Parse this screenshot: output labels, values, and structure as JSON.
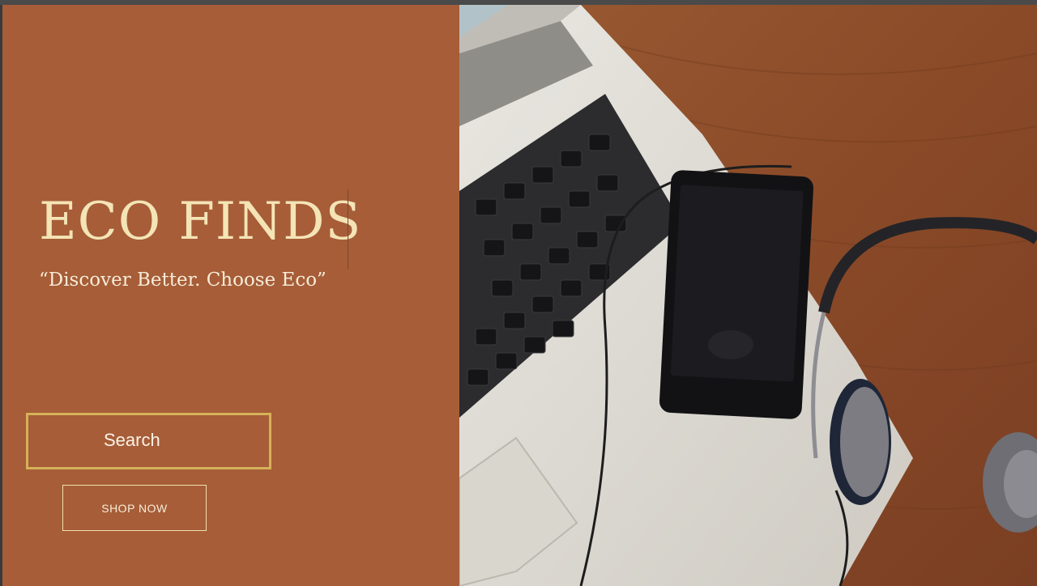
{
  "hero": {
    "title": "ECO FINDS",
    "tagline": "“Discover Better. Choose Eco”",
    "search_label": "Search",
    "shop_label": "SHOP NOW"
  },
  "photo": {
    "subject_icons": [
      "laptop-icon",
      "smartphone-icon",
      "headphones-icon"
    ]
  },
  "colors": {
    "panel": "#a65d38",
    "title": "#f4e4b6",
    "search_border": "#d6b15a",
    "wood": "#8a4a28"
  }
}
